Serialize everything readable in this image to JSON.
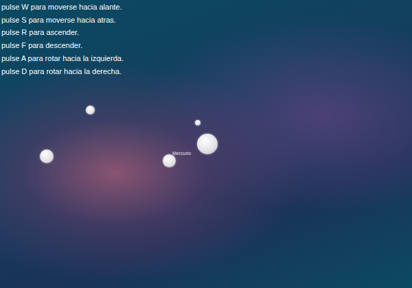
{
  "instructions": [
    "pulse W para moverse hacia alante.",
    "pulse S para moverse hacia atras.",
    "pulse R para ascender.",
    "pulse F para descender.",
    "pulse A para rotar hacia la izquierda.",
    "pulse D para rotar hacia la derecha."
  ],
  "planets": [
    {
      "label": ""
    },
    {
      "label": ""
    },
    {
      "label": ""
    },
    {
      "label": "Mercurio"
    },
    {
      "label": ""
    }
  ]
}
